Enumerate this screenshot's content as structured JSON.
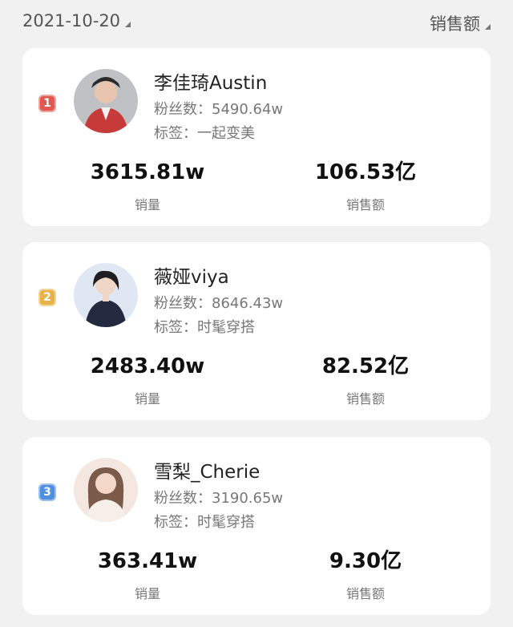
{
  "header": {
    "date": "2021-10-20",
    "sort_label": "销售额"
  },
  "colors": {
    "rank1": "#e0584f",
    "rank2": "#e8b24a",
    "rank3": "#4e8fe0"
  },
  "items": [
    {
      "rank": "1",
      "name": "李佳琦Austin",
      "fans": "粉丝数：5490.64w",
      "tag": "标签：一起变美",
      "sales_volume": "3615.81w",
      "sales_volume_label": "销量",
      "sales_amount": "106.53亿",
      "sales_amount_label": "销售额"
    },
    {
      "rank": "2",
      "name": "薇娅viya",
      "fans": "粉丝数：8646.43w",
      "tag": "标签：时髦穿搭",
      "sales_volume": "2483.40w",
      "sales_volume_label": "销量",
      "sales_amount": "82.52亿",
      "sales_amount_label": "销售额"
    },
    {
      "rank": "3",
      "name": "雪梨_Cherie",
      "fans": "粉丝数：3190.65w",
      "tag": "标签：时髦穿搭",
      "sales_volume": "363.41w",
      "sales_volume_label": "销量",
      "sales_amount": "9.30亿",
      "sales_amount_label": "销售额"
    }
  ]
}
